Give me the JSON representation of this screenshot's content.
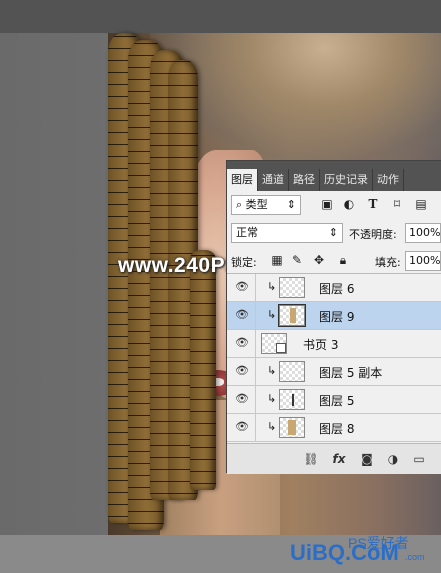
{
  "watermark": "www.240PS.com",
  "panel": {
    "tabs": [
      {
        "label": "图层",
        "active": true
      },
      {
        "label": "通道",
        "active": false
      },
      {
        "label": "路径",
        "active": false
      },
      {
        "label": "历史记录",
        "active": false
      },
      {
        "label": "动作",
        "active": false
      }
    ],
    "filter_kind": "类型",
    "filter_icons": [
      "image-filter-icon",
      "adjustment-filter-icon",
      "type-filter-icon",
      "shape-filter-icon",
      "smartobject-filter-icon"
    ],
    "blend_mode": "正常",
    "opacity_label": "不透明度:",
    "opacity_value": "100%",
    "lock_label": "锁定:",
    "fill_label": "填充:",
    "fill_value": "100%",
    "layers": [
      {
        "name": "图层 6",
        "clipped": true,
        "selected": false,
        "kind": "pixel"
      },
      {
        "name": "图层 9",
        "clipped": true,
        "selected": true,
        "kind": "pixel"
      },
      {
        "name": "书页 3",
        "clipped": false,
        "selected": false,
        "kind": "smart"
      },
      {
        "name": "图层 5 副本",
        "clipped": true,
        "selected": false,
        "kind": "pixel"
      },
      {
        "name": "图层 5",
        "clipped": true,
        "selected": false,
        "kind": "pixel"
      },
      {
        "name": "图层 8",
        "clipped": true,
        "selected": false,
        "kind": "pixel"
      }
    ],
    "footer_icons": [
      "link-icon",
      "fx-icon",
      "mask-icon",
      "adjustment-icon",
      "folder-icon"
    ]
  },
  "logo": {
    "main": "UiBQ.CoM",
    "sub": "PS爱好者",
    "domain": ".com"
  }
}
